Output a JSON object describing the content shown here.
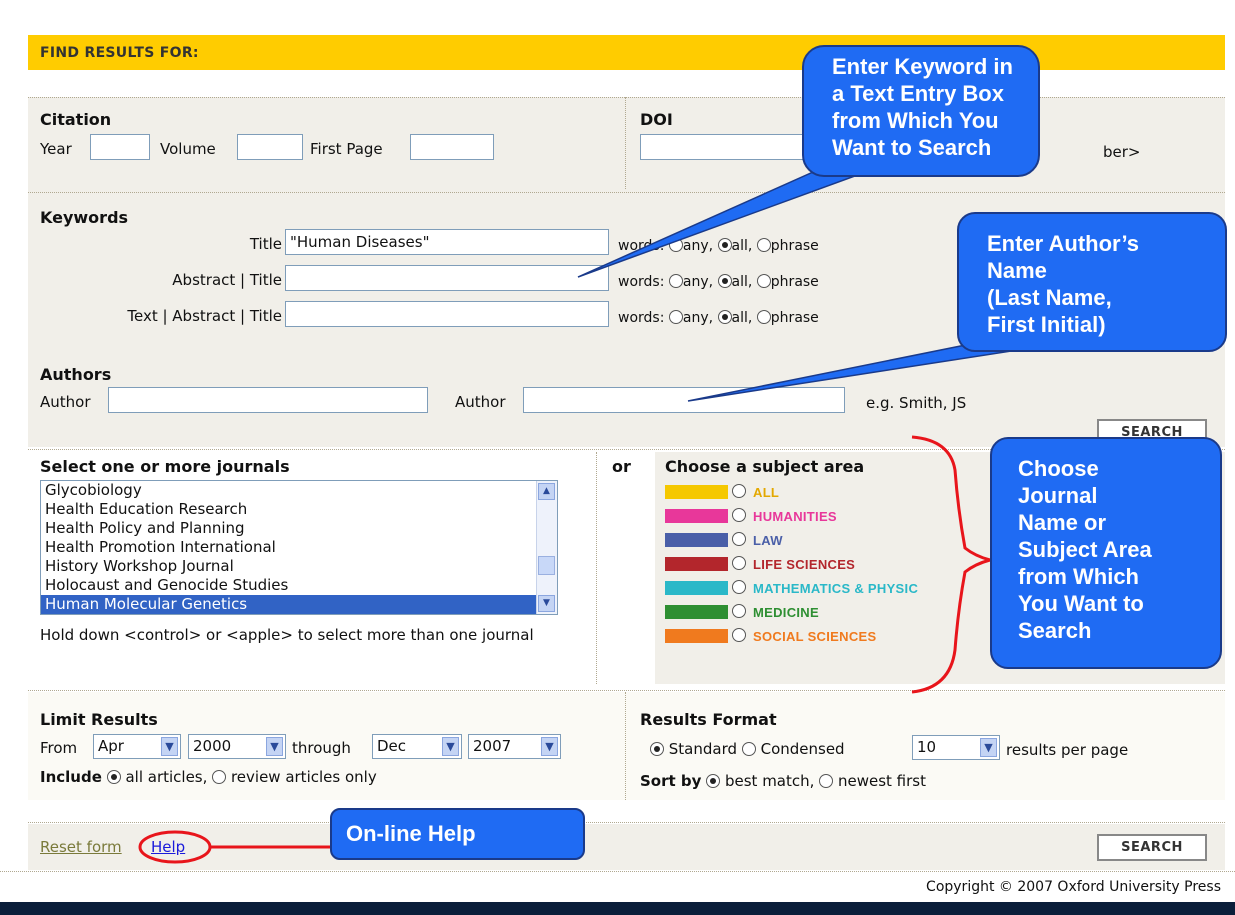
{
  "header": {
    "title": "FIND RESULTS FOR:"
  },
  "citation": {
    "heading": "Citation",
    "year_label": "Year",
    "volume_label": "Volume",
    "first_page_label": "First Page",
    "year_value": "",
    "volume_value": "",
    "first_page_value": ""
  },
  "doi": {
    "heading": "DOI",
    "value": "",
    "hint_tail": "ber>"
  },
  "keywords": {
    "heading": "Keywords",
    "rows": [
      {
        "label": "Title",
        "value": "\"Human Diseases\"",
        "words_label": "words:",
        "selected": "all"
      },
      {
        "label": "Abstract | Title",
        "value": "",
        "words_label": "words:",
        "selected": "all"
      },
      {
        "label": "Text | Abstract | Title",
        "value": "",
        "words_label": "words:",
        "selected": "all"
      }
    ],
    "options": [
      "any,",
      "all,",
      "phrase"
    ]
  },
  "authors": {
    "heading": "Authors",
    "author1_label": "Author",
    "author2_label": "Author",
    "author1_value": "",
    "author2_value": "",
    "example": "e.g. Smith, JS",
    "search_label": "SEARCH"
  },
  "journals": {
    "heading": "Select one or more journals",
    "items": [
      "Glycobiology",
      "Health Education Research",
      "Health Policy and Planning",
      "Health Promotion International",
      "History Workshop Journal",
      "Holocaust and Genocide Studies",
      "Human Molecular Genetics"
    ],
    "selected": "Human Molecular Genetics",
    "hint": "Hold down <control> or <apple> to select more than one journal"
  },
  "subject": {
    "or_label": "or",
    "heading": "Choose a subject area",
    "areas": [
      {
        "label": "ALL",
        "color": "#f5c800"
      },
      {
        "label": "HUMANITIES",
        "color": "#e8379a"
      },
      {
        "label": "LAW",
        "color": "#4a5fa8"
      },
      {
        "label": "LIFE SCIENCES",
        "color": "#b3262c"
      },
      {
        "label": "MATHEMATICS & PHYSIC",
        "color": "#2ab8c8"
      },
      {
        "label": "MEDICINE",
        "color": "#2e8f32"
      },
      {
        "label": "SOCIAL SCIENCES",
        "color": "#f07a1e"
      }
    ]
  },
  "limit": {
    "heading": "Limit Results",
    "from_label": "From",
    "from_month": "Apr",
    "from_year": "2000",
    "through_label": "through",
    "to_month": "Dec",
    "to_year": "2007",
    "include_label": "Include",
    "include_all": "all articles,",
    "include_review": "review articles only"
  },
  "format": {
    "heading": "Results Format",
    "standard": "Standard",
    "condensed": "Condensed",
    "per_page": "10",
    "per_page_label": "results per page",
    "sort_label": "Sort by",
    "sort_best": "best match,",
    "sort_newest": "newest first"
  },
  "footer": {
    "reset_label": "Reset form",
    "help_label": "Help",
    "search_label": "SEARCH",
    "copyright": "Copyright © 2007 Oxford University Press"
  },
  "callouts": {
    "keyword": "Enter Keyword in\na Text Entry Box\nfrom Which You\nWant to Search",
    "author": "Enter Author’s\nName\n(Last Name,\nFirst Initial)",
    "journal": "Choose\nJournal\nName or\nSubject Area\nfrom Which\nYou Want to\nSearch",
    "help": "On-line Help"
  },
  "colors": {
    "header": "#ffcc00",
    "panel": "#f1efe9",
    "callout": "#1f6bf3",
    "annotation_red": "#e8151b",
    "footer_bar": "#0a1e3a"
  }
}
